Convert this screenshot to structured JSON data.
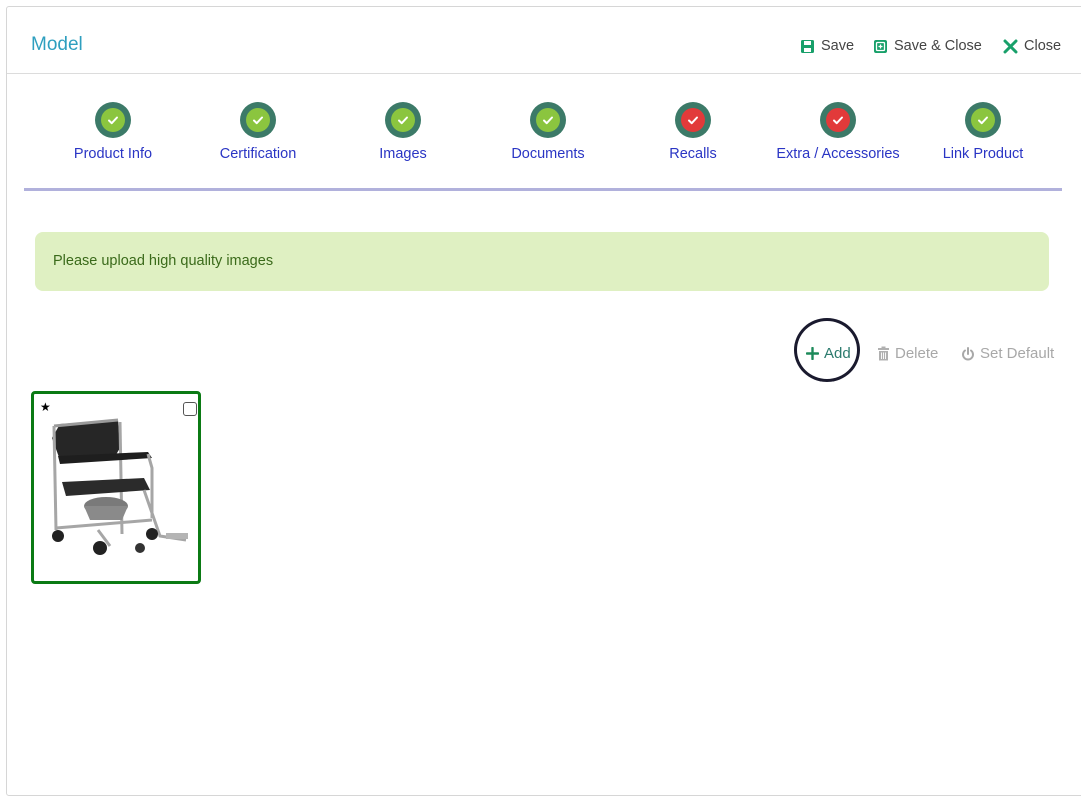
{
  "header": {
    "title": "Model",
    "save_label": "Save",
    "save_close_label": "Save & Close",
    "close_label": "Close"
  },
  "steps": [
    {
      "label": "Product Info",
      "status": "complete"
    },
    {
      "label": "Certification",
      "status": "complete"
    },
    {
      "label": "Images",
      "status": "complete"
    },
    {
      "label": "Documents",
      "status": "complete"
    },
    {
      "label": "Recalls",
      "status": "incomplete"
    },
    {
      "label": "Extra / Accessories",
      "status": "incomplete"
    },
    {
      "label": "Link Product",
      "status": "complete"
    }
  ],
  "alert": {
    "message": "Please upload high quality images"
  },
  "toolbar": {
    "add_label": "Add",
    "delete_label": "Delete",
    "set_default_label": "Set Default"
  },
  "images": [
    {
      "default": true,
      "selected": false,
      "icon": "wheelchair-image"
    }
  ],
  "colors": {
    "accent": "#2e9fbf",
    "step_complete": "#8bc53f",
    "step_incomplete": "#e23a3a",
    "step_ring": "#3c7a68",
    "step_label": "#2a35c4",
    "alert_bg": "#dff0c2",
    "card_border": "#0b7a14"
  }
}
